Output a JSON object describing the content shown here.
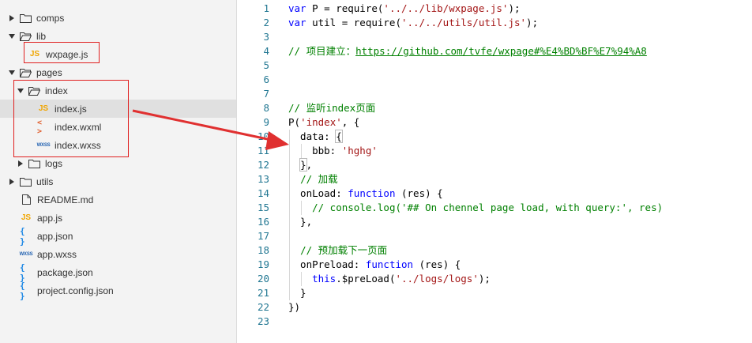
{
  "sidebar": {
    "items": [
      {
        "label": "comps",
        "type": "folder",
        "state": "collapsed"
      },
      {
        "label": "lib",
        "type": "folder",
        "state": "expanded"
      },
      {
        "label": "wxpage.js",
        "type": "js"
      },
      {
        "label": "pages",
        "type": "folder",
        "state": "expanded"
      },
      {
        "label": "index",
        "type": "folder",
        "state": "expanded"
      },
      {
        "label": "index.js",
        "type": "js",
        "selected": true
      },
      {
        "label": "index.wxml",
        "type": "wxml"
      },
      {
        "label": "index.wxss",
        "type": "wxss"
      },
      {
        "label": "logs",
        "type": "folder",
        "state": "collapsed"
      },
      {
        "label": "utils",
        "type": "folder",
        "state": "collapsed"
      },
      {
        "label": "README.md",
        "type": "file"
      },
      {
        "label": "app.js",
        "type": "js"
      },
      {
        "label": "app.json",
        "type": "json"
      },
      {
        "label": "app.wxss",
        "type": "wxss"
      },
      {
        "label": "package.json",
        "type": "json"
      },
      {
        "label": "project.config.json",
        "type": "json"
      }
    ],
    "icon_glyphs": {
      "js": "JS",
      "json": "{ }",
      "wxml": "< >",
      "wxss": "WXSS"
    }
  },
  "editor": {
    "line_numbers": [
      "1",
      "2",
      "3",
      "4",
      "5",
      "6",
      "7",
      "8",
      "9",
      "10",
      "11",
      "12",
      "13",
      "14",
      "15",
      "16",
      "17",
      "18",
      "19",
      "20",
      "21",
      "22",
      "23"
    ]
  },
  "annotation": {
    "arrow_color": "#e03030",
    "box_color": "#e02020"
  }
}
